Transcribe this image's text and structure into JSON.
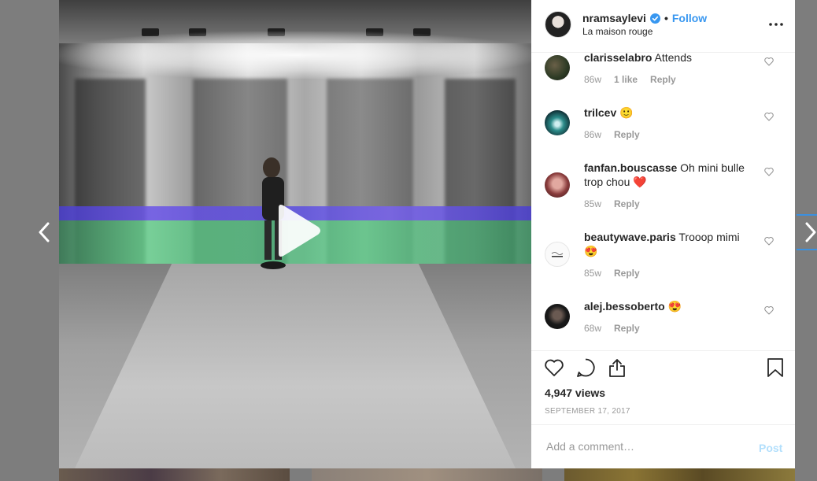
{
  "post": {
    "username": "nramsaylevi",
    "follow_label": "Follow",
    "separator": "•",
    "location": "La maison rouge"
  },
  "comments": [
    {
      "username": "clarisselabro",
      "text": "Attends",
      "emoji": "",
      "age": "86w",
      "likes": "1 like",
      "reply_label": "Reply"
    },
    {
      "username": "trilcev",
      "text": "",
      "emoji": "🙂",
      "age": "86w",
      "likes": "",
      "reply_label": "Reply"
    },
    {
      "username": "fanfan.bouscasse",
      "text": "Oh mini bulle trop chou",
      "emoji": "❤️",
      "age": "85w",
      "likes": "",
      "reply_label": "Reply"
    },
    {
      "username": "beautywave.paris",
      "text": "Trooop mimi",
      "emoji": "😍",
      "age": "85w",
      "likes": "",
      "reply_label": "Reply"
    },
    {
      "username": "alej.bessoberto",
      "text": "",
      "emoji": "😍",
      "age": "68w",
      "likes": "",
      "reply_label": "Reply"
    }
  ],
  "stats": {
    "views": "4,947 views",
    "date": "SEPTEMBER 17, 2017"
  },
  "add_comment": {
    "placeholder": "Add a comment…",
    "post_label": "Post"
  },
  "colors": {
    "accent": "#3897f0",
    "post_disabled": "#b2dffc",
    "muted": "#999999",
    "text": "#262626"
  }
}
